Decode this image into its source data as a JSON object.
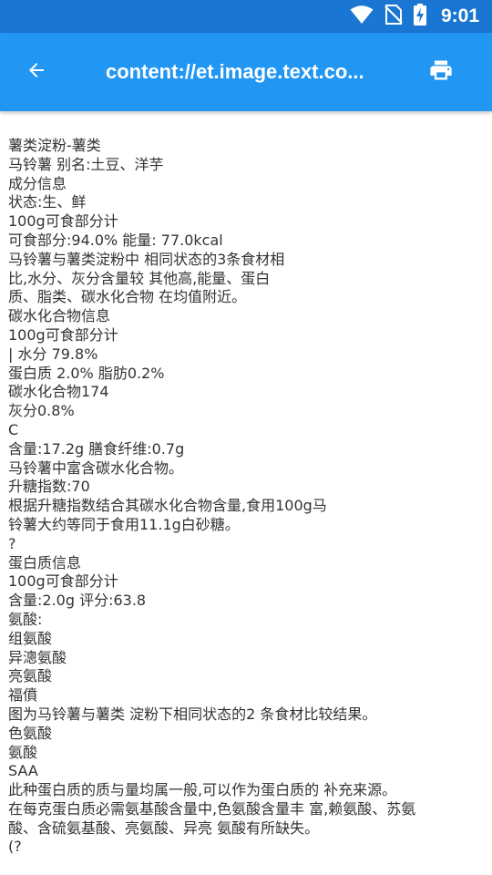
{
  "status_bar": {
    "time": "9:01",
    "icons": [
      "wifi-icon",
      "no-sim-icon",
      "battery-charging-icon"
    ]
  },
  "app_bar": {
    "back_icon": "arrow-back-icon",
    "title": "content://et.image.text.co...",
    "print_icon": "print-icon"
  },
  "document": {
    "lines": [
      "薯类淀粉-薯类",
      "马铃薯 别名:土豆、洋芋",
      "成分信息",
      "状态:生、鲜",
      "100g可食部分计",
      "可食部分:94.0% 能量: 77.0kcal",
      "马铃薯与薯类淀粉中 相同状态的3条食材相",
      "比,水分、灰分含量较 其他高,能量、蛋白",
      "质、脂类、碳水化合物 在均值附近。",
      "碳水化合物信息",
      "100g可食部分计",
      "| 水分 79.8%",
      "蛋白质 2.0% 脂肪0.2%",
      "碳水化合物174",
      "灰分0.8%",
      "C",
      "含量:17.2g 膳食纤维:0.7g",
      "马铃薯中富含碳水化合物。",
      "升糖指数:70",
      "根据升糖指数结合其碳水化合物含量,食用100g马",
      "铃薯大约等同于食用11.1g白砂糖。",
      "?",
      "蛋白质信息",
      "100g可食部分计",
      "含量:2.0g 评分:63.8",
      "氨酸:",
      "组氨酸",
      "异漗氨酸",
      "亮氨酸",
      "福僨",
      "图为马铃薯与薯类 淀粉下相同状态的2 条食材比较结果。",
      "色氨酸",
      "氨酸",
      "SAA",
      "此种蛋白质的质与量均属一般,可以作为蛋白质的 补充来源。",
      "在每克蛋白质必需氨基酸含量中,色氨酸含量丰 富,赖氨酸、苏氨",
      "酸、含硫氨基酸、亮氨酸、异亮 氨酸有所缺失。",
      "(?"
    ]
  }
}
